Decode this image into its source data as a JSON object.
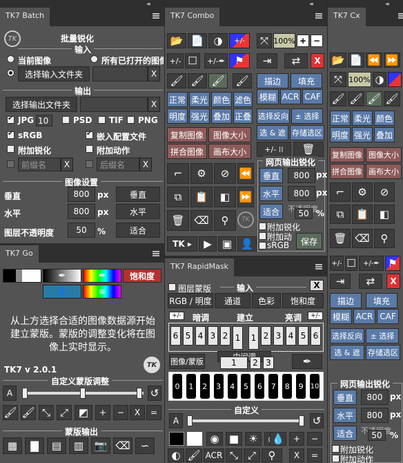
{
  "colors": {
    "panel": "#535353",
    "dark": "#3d3d3d",
    "blue": "#5a7aa8",
    "red": "#8e5a5a",
    "green": "#5a6b5a"
  },
  "batch": {
    "tab": "TK7 Batch",
    "title": "批量锐化",
    "input_header": "输入",
    "radio_current": "当前图像",
    "radio_all": "所有已打开的图像",
    "select_input": "选择输入文件夹",
    "x": "X",
    "output_header": "输出",
    "select_output": "选择输出文件夹",
    "jpg": "JPG",
    "jpg_q": "10",
    "psd": "PSD",
    "tif": "TIF",
    "png": "PNG",
    "srgb": "sRGB",
    "embed": "嵌入配置文件",
    "add_sharp": "附加锐化",
    "add_action": "附加动作",
    "prefix": "前缀名",
    "suffix": "后缀名",
    "size_header": "图像设置",
    "vertical": "垂直",
    "v_val": "800",
    "px": "px",
    "v_btn": "垂直",
    "horizontal": "水平",
    "h_val": "800",
    "h_btn": "水平",
    "opacity": "图层不透明度",
    "op_val": "50",
    "pct": "%",
    "fit": "适合"
  },
  "go": {
    "tab": "TK7 Go",
    "sat": "饱和度",
    "msg": "从上方选择合适的图像数据源开始建立蒙版。蒙版的调整变化将在图像上实时显示。",
    "version": "TK7 v 2.0.1",
    "custom_mask": "自定义蒙版调整",
    "A": "A",
    "mask_output": "蒙版输出",
    "plus": "+",
    "minus": "−",
    "x": "X",
    "eq": "="
  },
  "combo": {
    "tab": "TK7 Combo",
    "pct100": "100%",
    "plus": "+",
    "minus": "−",
    "pm": "+/-",
    "x": "X",
    "stroke": "描边",
    "fill": "填充",
    "normal": "正常",
    "soft": "柔光",
    "color": "颜色",
    "filter": "滤色",
    "blur": "模糊",
    "acr": "ACR",
    "caf": "CAF",
    "luminosity": "明度",
    "strong": "强光",
    "overlay": "叠加",
    "multiply": "正叠",
    "inv_sel": "选择反向",
    "pm_sel": "± 选择",
    "copy_img": "复制图像",
    "img_size": "图像大小",
    "sel_trans": "选 & 遮",
    "save_sel": "存储选区",
    "merge_img": "拼合图像",
    "canvas": "画布大小",
    "web_sharp": "网页输出锐化",
    "vertical": "垂直",
    "v_val": "800",
    "px": "px",
    "horizontal": "水平",
    "h_val": "800",
    "fit": "适合",
    "opacity_lbl": "不透明度",
    "op_val": "50",
    "pct": "%",
    "add_sharp": "附加锐化",
    "add_action": "附加动",
    "srgb": "sRGB",
    "save": "保存",
    "tk": "TK"
  },
  "rapid": {
    "tab": "TK7 RapidMask",
    "layer_mask": "图层蒙版",
    "input": "输入",
    "x": "X",
    "rgb_lum": "RGB / 明度",
    "channel": "通道",
    "color": "色彩",
    "sat": "饱和度",
    "dark": "暗调",
    "build": "建立",
    "light": "亮调",
    "pm": "+/-",
    "nums_left": [
      "6",
      "5",
      "4",
      "3",
      "2",
      "1"
    ],
    "nums_right": [
      "1",
      "2",
      "3",
      "4",
      "5",
      "6"
    ],
    "img_mask": "图像/蒙版",
    "mid": "中间调",
    "mid_nums": [
      "1",
      "2",
      "3"
    ],
    "zones": [
      "0",
      "1",
      "2",
      "3",
      "4",
      "5",
      "6",
      "7",
      "8",
      "9",
      "10"
    ],
    "custom": "自定义",
    "A": "A",
    "plus": "+",
    "minus": "−",
    "x2": "X",
    "eq": "=",
    "acr": "ACR"
  },
  "cx": {
    "tab": "TK7 Cx",
    "pct100": "100%",
    "pm": "+/-",
    "stroke": "描边",
    "fill": "填充",
    "blur": "模糊",
    "acr": "ACR",
    "caf": "CAF",
    "normal": "正常",
    "soft": "柔光",
    "color": "颜色",
    "luminosity": "明度",
    "strong": "强光",
    "overlay": "叠加",
    "inv_sel": "选择反向",
    "pm_sel": "± 选择",
    "sel_trans": "选 & 遮",
    "save_sel": "存储选区",
    "copy_img": "复制图像",
    "img_size": "图像大小",
    "merge_img": "拼合图像",
    "canvas": "画布大小",
    "web_sharp": "网页输出锐化",
    "vertical": "垂直",
    "v_val": "800",
    "px": "px",
    "horizontal": "水平",
    "h_val": "800",
    "fit": "适合",
    "opacity_lbl": "不透明度",
    "op_val": "50",
    "pct": "%",
    "add_sharp": "附加锐化",
    "add_action": "附加动作",
    "x": "X"
  }
}
